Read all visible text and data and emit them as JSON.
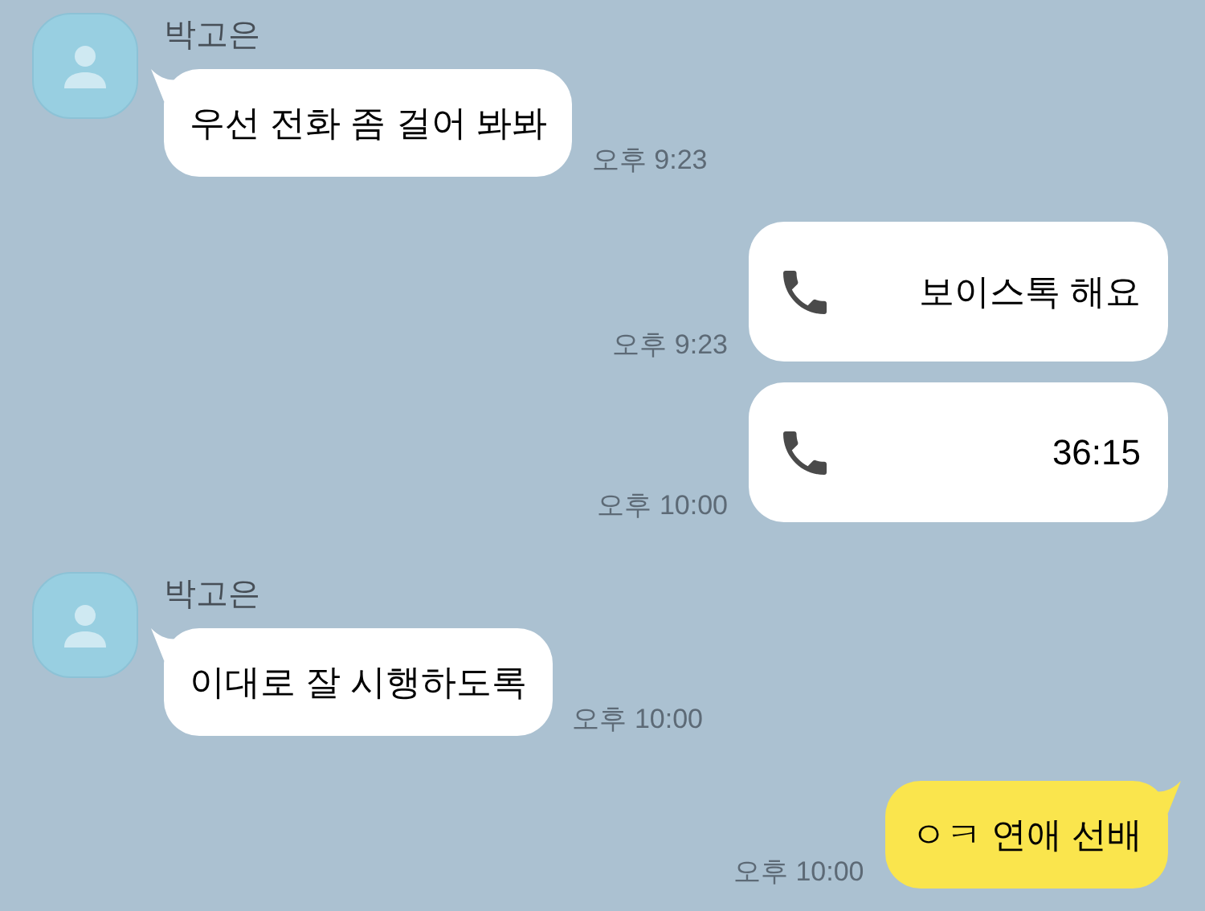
{
  "messages": [
    {
      "outgoing": false,
      "sender": "박고은",
      "kind": "text",
      "tail": true,
      "text": "우선 전화 좀 걸어 봐봐",
      "time": "오후 9:23"
    },
    {
      "outgoing": true,
      "kind": "call",
      "tail": false,
      "text": "보이스톡 해요",
      "time": "오후 9:23"
    },
    {
      "outgoing": true,
      "kind": "call",
      "tail": false,
      "text": "36:15",
      "time": "오후 10:00"
    },
    {
      "outgoing": false,
      "sender": "박고은",
      "kind": "text",
      "tail": true,
      "text": "이대로 잘 시행하도록",
      "time": "오후 10:00"
    },
    {
      "outgoing": true,
      "kind": "text",
      "tail": true,
      "text": "ㅇㅋ 연애 선배",
      "time": "오후 10:00"
    }
  ]
}
